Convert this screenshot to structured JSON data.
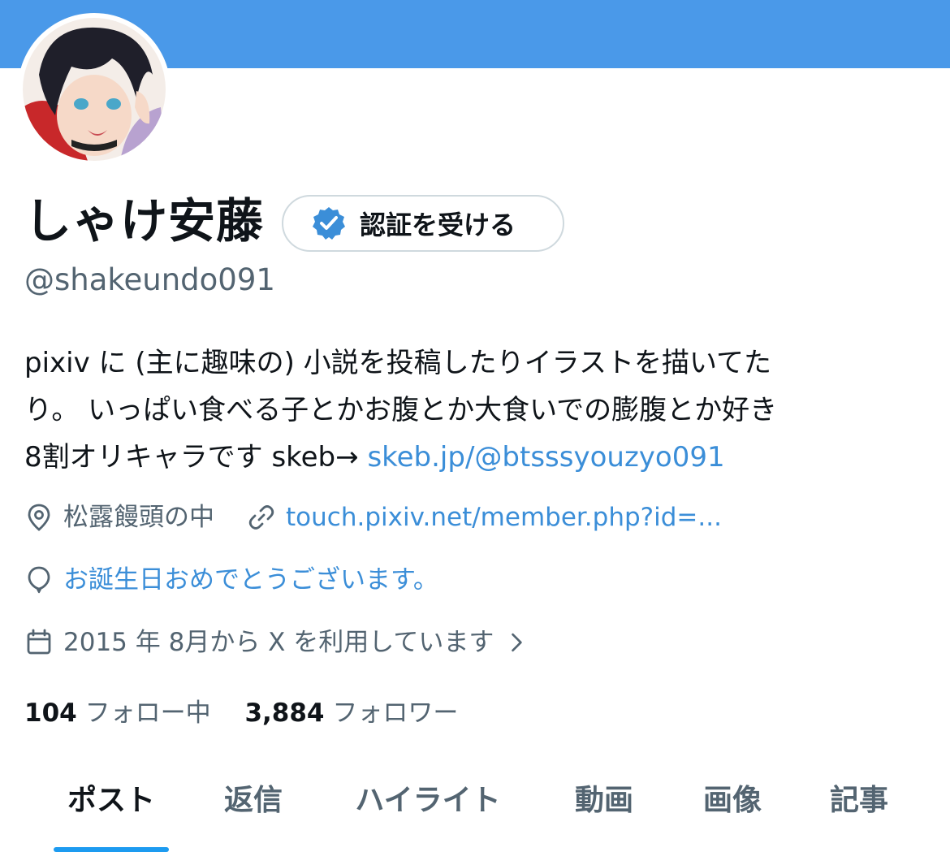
{
  "profile": {
    "display_name": "しゃけ安藤",
    "handle": "@shakeundo091",
    "verify_button_label": "認証を受ける"
  },
  "bio": {
    "line1": "pixiv に (主に趣味の) 小説を投稿したりイラストを描いてた",
    "line2": "り。 いっぱい食べる子とかお腹とか大食いでの膨腹とか好き",
    "line3_text": "8割オリキャラです skeb→ ",
    "line3_link": "skeb.jp/@btsssyouzyo091"
  },
  "meta": {
    "location": "松露饅頭の中",
    "website": "touch.pixiv.net/member.php?id=...",
    "birthday": "お誕生日おめでとうございます。",
    "joined": "2015 年 8月から X を利用しています"
  },
  "stats": {
    "following_count": "104",
    "following_label": "フォロー中",
    "followers_count": "3,884",
    "followers_label": "フォロワー"
  },
  "tabs": [
    {
      "label": "ポスト",
      "active": true
    },
    {
      "label": "返信",
      "active": false
    },
    {
      "label": "ハイライト",
      "active": false
    },
    {
      "label": "動画",
      "active": false
    },
    {
      "label": "画像",
      "active": false
    },
    {
      "label": "記事",
      "active": false
    }
  ],
  "colors": {
    "banner": "#4a99e9",
    "link": "#3b8ed8",
    "verified_badge": "#3b8ed8",
    "secondary_text": "#536471",
    "tab_indicator": "#1d9bf0"
  },
  "icons": {
    "verified": "verified-badge-icon",
    "location": "location-pin-icon",
    "website": "link-icon",
    "birthday": "balloon-icon",
    "joined": "calendar-icon",
    "joined_chevron": "chevron-right-icon"
  }
}
